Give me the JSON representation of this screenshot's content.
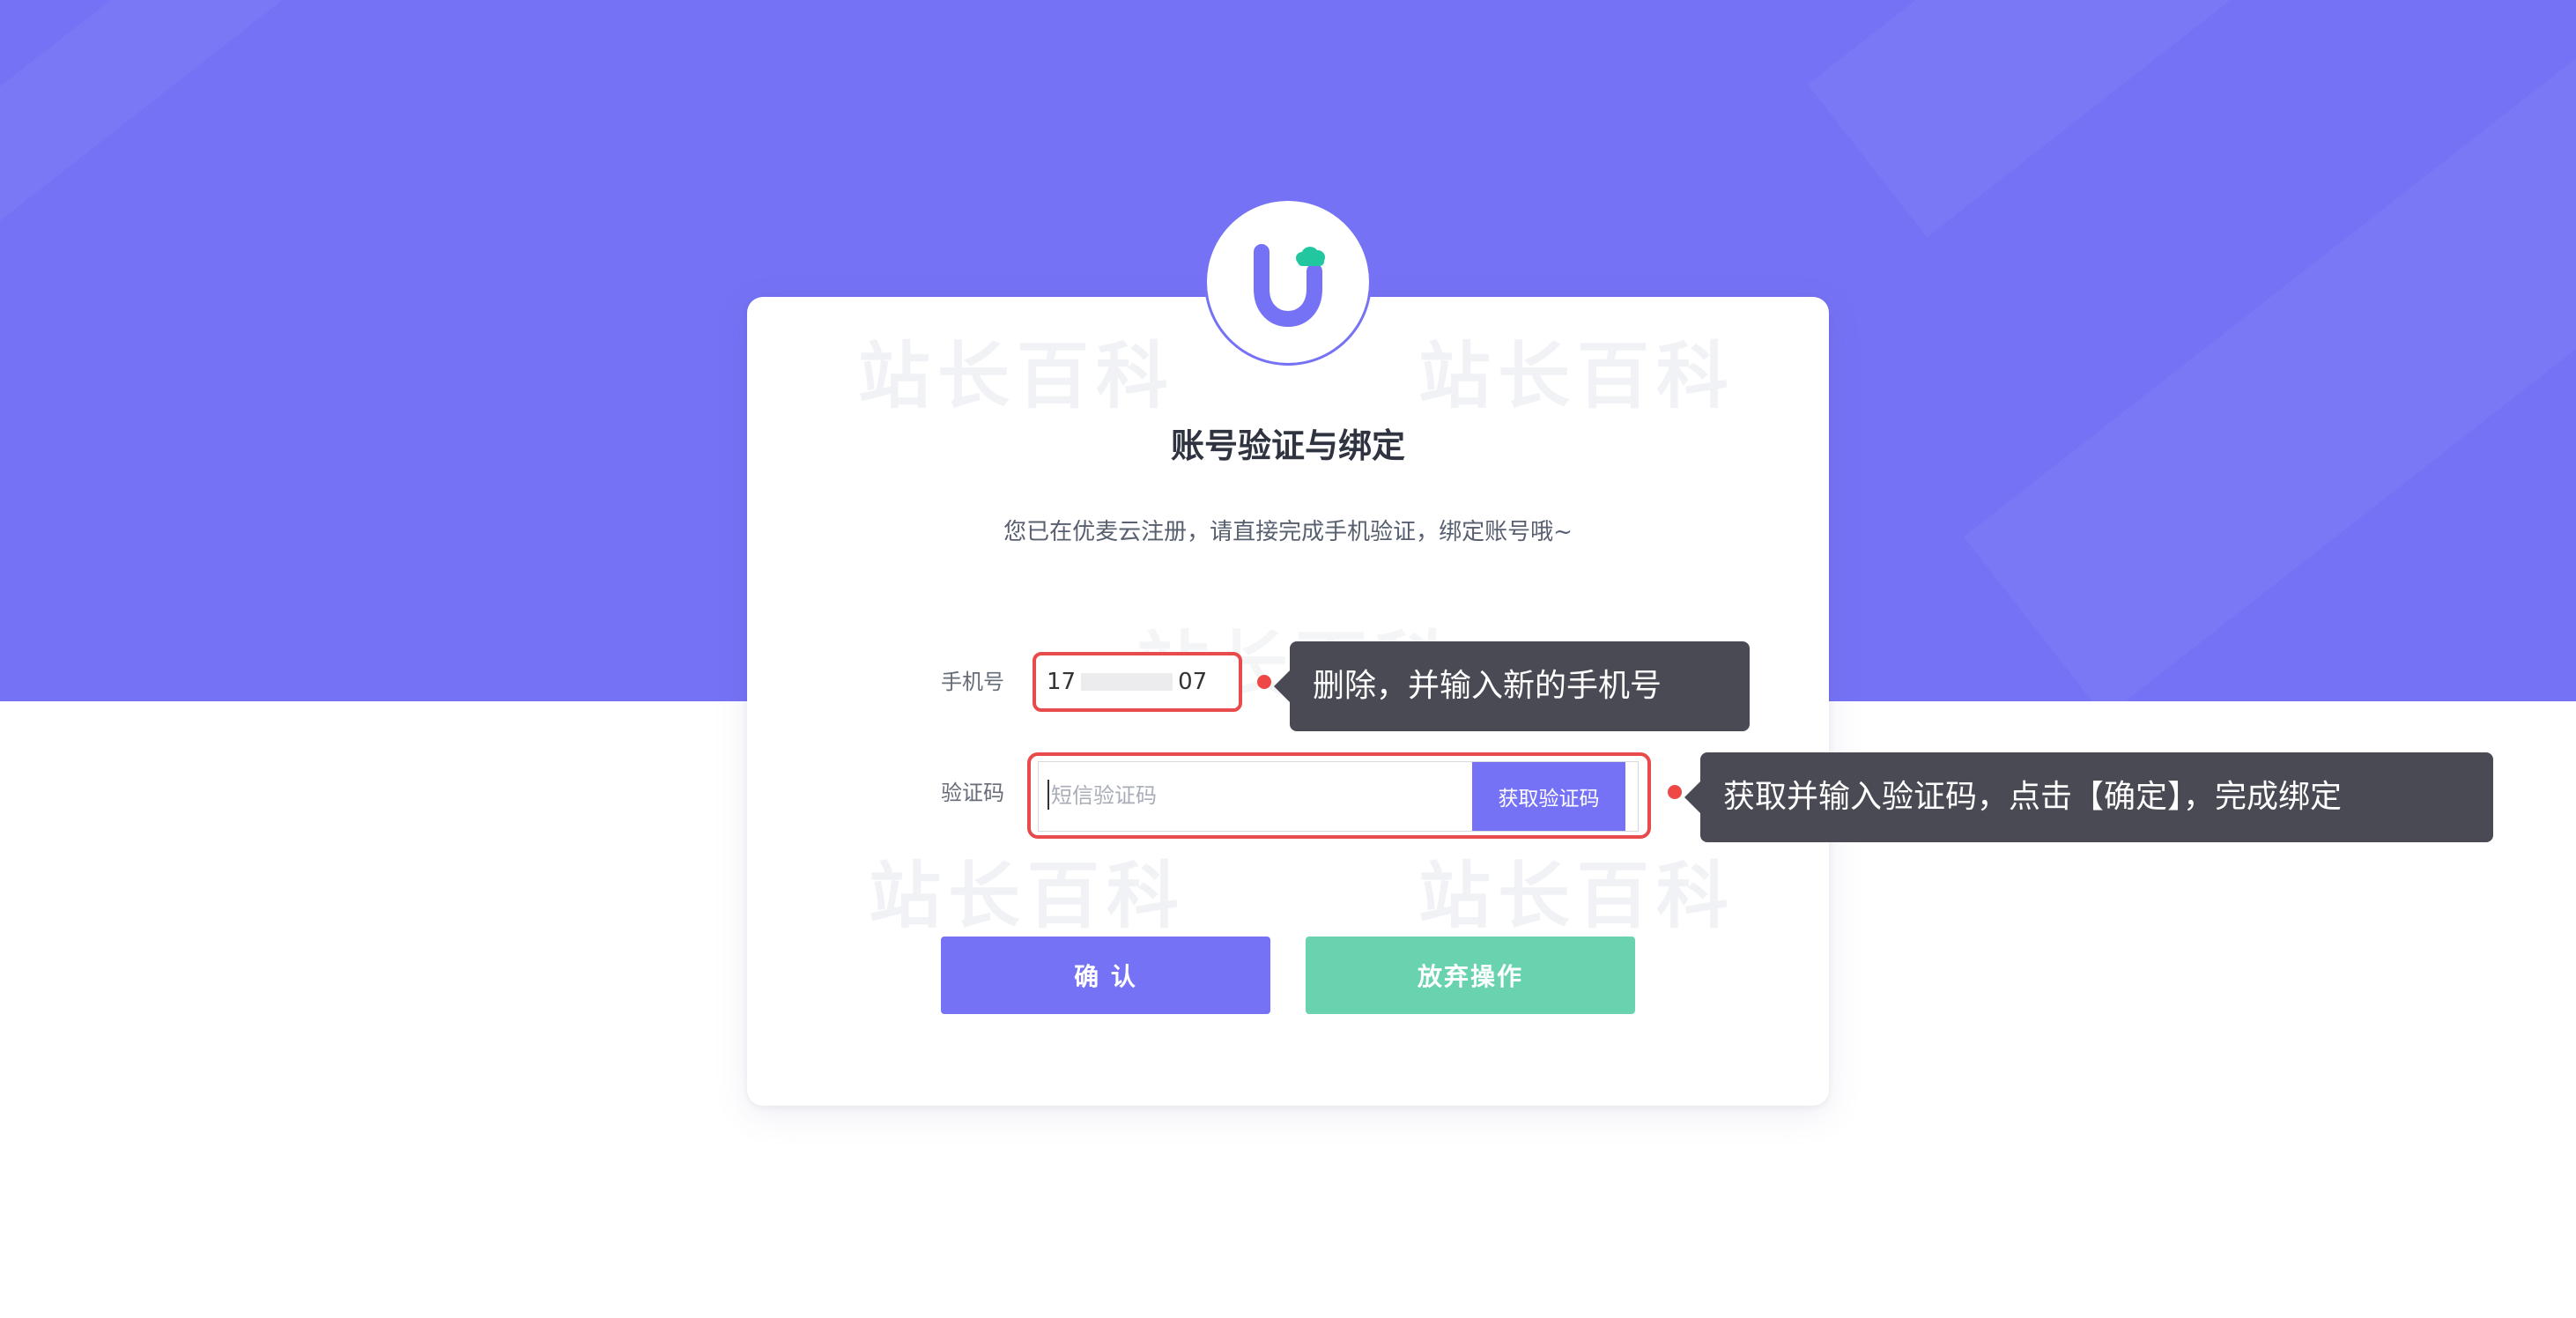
{
  "colors": {
    "brand_purple": "#7672f5",
    "accent_green": "#68d3ae",
    "highlight_red": "#e84b4b",
    "tooltip_bg": "#494a54"
  },
  "watermarks": [
    "站长百科",
    "站长百科",
    "站长百科",
    "站长百科",
    "站长百科"
  ],
  "header": {
    "title": "账号验证与绑定",
    "subtitle": "您已在优麦云注册，请直接完成手机验证，绑定账号哦~"
  },
  "form": {
    "phone_label": "手机号",
    "phone_value_visible_prefix": "17",
    "phone_value_visible_suffix": "07",
    "code_label": "验证码",
    "code_placeholder": "短信验证码",
    "get_code_button": "获取验证码"
  },
  "annotations": {
    "phone_tip": "删除，并输入新的手机号",
    "code_tip": "获取并输入验证码，点击【确定】，完成绑定"
  },
  "actions": {
    "confirm": "确 认",
    "abort": "放弃操作"
  },
  "icons": {
    "logo": "brand-u-logo-icon",
    "cloud": "cloud-icon"
  }
}
